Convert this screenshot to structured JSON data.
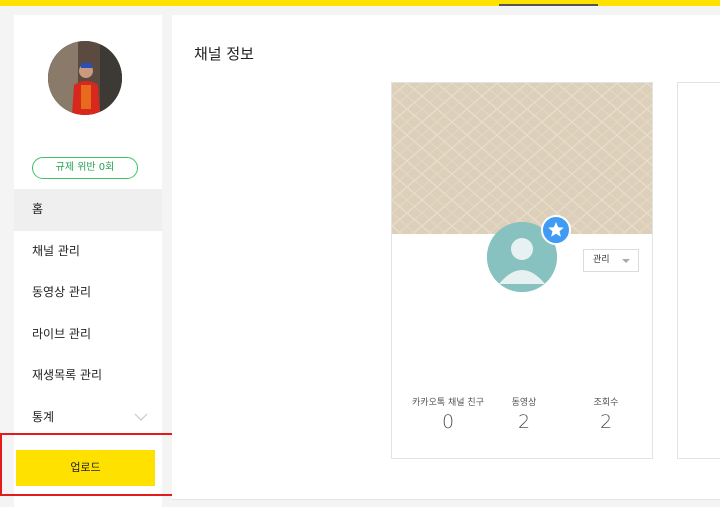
{
  "sidebar": {
    "violation_badge": "규제 위반 0회",
    "menu": [
      {
        "label": "홈",
        "active": true
      },
      {
        "label": "채널 관리"
      },
      {
        "label": "동영상 관리"
      },
      {
        "label": "라이브 관리"
      },
      {
        "label": "재생목록 관리"
      },
      {
        "label": "통계",
        "has_chevron": true
      }
    ],
    "upload_label": "업로드"
  },
  "main": {
    "title": "채널 정보",
    "card": {
      "manage_select": "관리",
      "stats": [
        {
          "label": "카카오톡 채널 친구",
          "value": "0"
        },
        {
          "label": "동영상",
          "value": "2"
        },
        {
          "label": "조회수",
          "value": "2"
        }
      ]
    }
  },
  "colors": {
    "brand_yellow": "#ffe100",
    "badge_green": "#27a153",
    "highlight_red": "#e21b1b",
    "star_blue": "#3f9bf4"
  }
}
